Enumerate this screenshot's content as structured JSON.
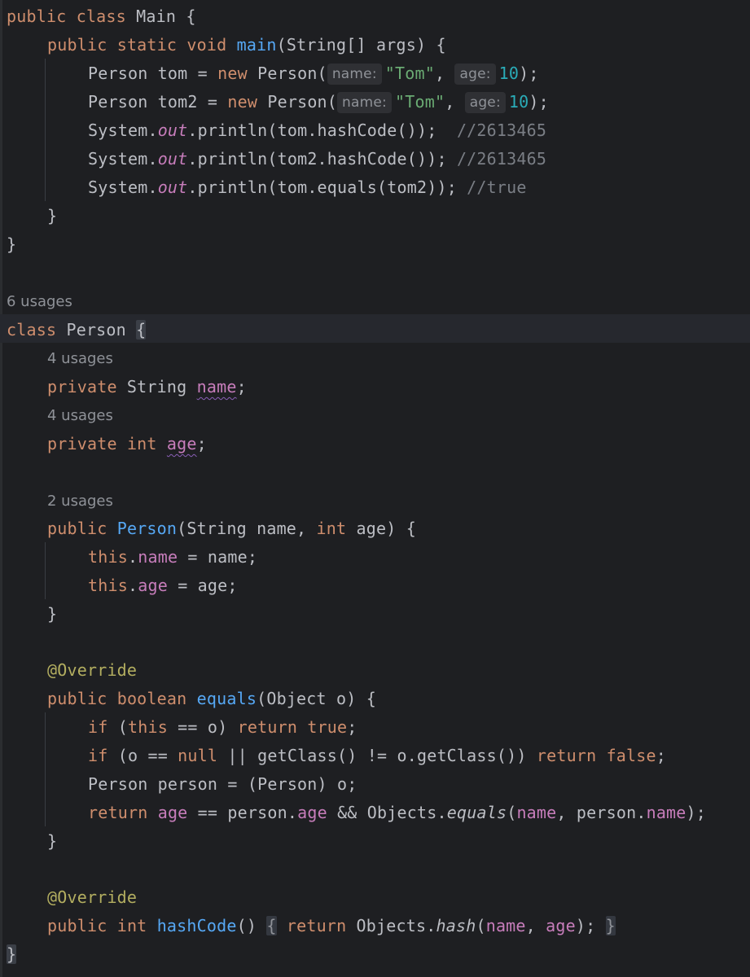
{
  "editor": {
    "language": "Java",
    "main_class": {
      "signature": "public class Main {",
      "main_method": "public static void main(String[] args) {",
      "tom_line": "Person tom = new Person(",
      "tom2_line": "Person tom2 = new Person(",
      "hint_name": "name:",
      "hint_age": "age:",
      "name_value": "\"Tom\"",
      "age_value": "10",
      "print_hash_tom": "System.out.println(tom.hashCode());",
      "print_hash_tom2": "System.out.println(tom2.hashCode());",
      "print_equals": "System.out.println(tom.equals(tom2));",
      "comment_hash_tom": "//2613465",
      "comment_hash_tom2": "//2613465",
      "comment_equals": "//true"
    },
    "person_class": {
      "class_usages": "6 usages",
      "signature": "class Person {",
      "name_usages": "4 usages",
      "name_field": "private String name;",
      "age_usages": "4 usages",
      "age_field": "private int age;",
      "constructor_usages": "2 usages",
      "constructor": "public Person(String name, int age) {",
      "assign_name": "this.name = name;",
      "assign_age": "this.age = age;",
      "override_1": "@Override",
      "equals_signature": "public boolean equals(Object o) {",
      "equals_line_1": "if (this == o) return true;",
      "equals_line_2": "if (o == null || getClass() != o.getClass()) return false;",
      "equals_line_3": "Person person = (Person) o;",
      "equals_line_4": "return age == person.age && Objects.equals(name, person.name);",
      "override_2": "@Override",
      "hashcode_line": "public int hashCode() { return Objects.hash(name, age); }"
    },
    "colors": {
      "background": "#1e1f22",
      "keyword": "#cf8e6d",
      "method": "#56a8f5",
      "string": "#6aab73",
      "number": "#2aacb8",
      "comment": "#7a7e85",
      "field": "#c77dbb",
      "annotation": "#b3ae60",
      "plain": "#bcbec4"
    }
  }
}
